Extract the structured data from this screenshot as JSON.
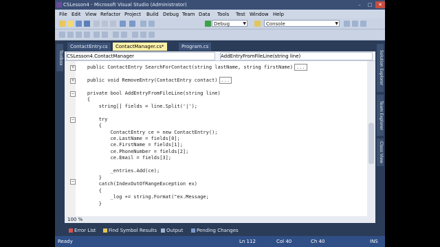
{
  "window": {
    "title": "CSLesson4 - Microsoft Visual Studio (Administrator)"
  },
  "menu": [
    "File",
    "Edit",
    "View",
    "Refactor",
    "Project",
    "Build",
    "Debug",
    "Team",
    "Data",
    "Tools",
    "Test",
    "Window",
    "Help"
  ],
  "toolbar": {
    "config": "Debug",
    "platform": "Console"
  },
  "side_tabs": {
    "left": "Toolbox",
    "right1": "Solution Explorer",
    "right2": "Team Explorer",
    "right3": "Class View"
  },
  "doc_tabs": [
    "ContactEntry.cs",
    "ContactManager.cs*",
    "Program.cs"
  ],
  "nav": {
    "class": "CSLesson4.ContactManager",
    "member": "AddEntryFromFileLine(string line)"
  },
  "code": [
    {
      "t": "    public ContactEntry SearchForContact(string lastName, string firstName)"
    },
    {
      "t": ""
    },
    {
      "t": "    public void RemoveEntry(ContactEntry contact)"
    },
    {
      "t": ""
    },
    {
      "t": "    private bool AddEntryFromFileLine(string line)"
    },
    {
      "t": "    {"
    },
    {
      "t": "        string[] fields = line.Split('|');"
    },
    {
      "t": ""
    },
    {
      "t": "        try"
    },
    {
      "t": "        {"
    },
    {
      "t": "            ContactEntry ce = new ContactEntry();"
    },
    {
      "t": "            ce.LastName = fields[0];"
    },
    {
      "t": "            ce.FirstName = fields[1];"
    },
    {
      "t": "            ce.PhoneNumber = fields[2];"
    },
    {
      "t": "            ce.Email = fields[3];"
    },
    {
      "t": ""
    },
    {
      "t": "            _entries.Add(ce);"
    },
    {
      "t": "        }"
    },
    {
      "t": "        catch(IndexOutOfRangeException ex)"
    },
    {
      "t": "        {"
    },
    {
      "t": "            _log += string.Format(\"ex.Message;"
    },
    {
      "t": "        }"
    }
  ],
  "zoom": "100 %",
  "bottom_tabs": [
    "Error List",
    "Find Symbol Results",
    "Output",
    "Pending Changes"
  ],
  "status": {
    "left": "Ready",
    "ln": "Ln 112",
    "col": "Col 40",
    "ch": "Ch 40",
    "ins": "INS"
  },
  "colors": {
    "frame": "#2b3c59",
    "active_tab": "#fff2a8",
    "status": "#2f4f86"
  }
}
